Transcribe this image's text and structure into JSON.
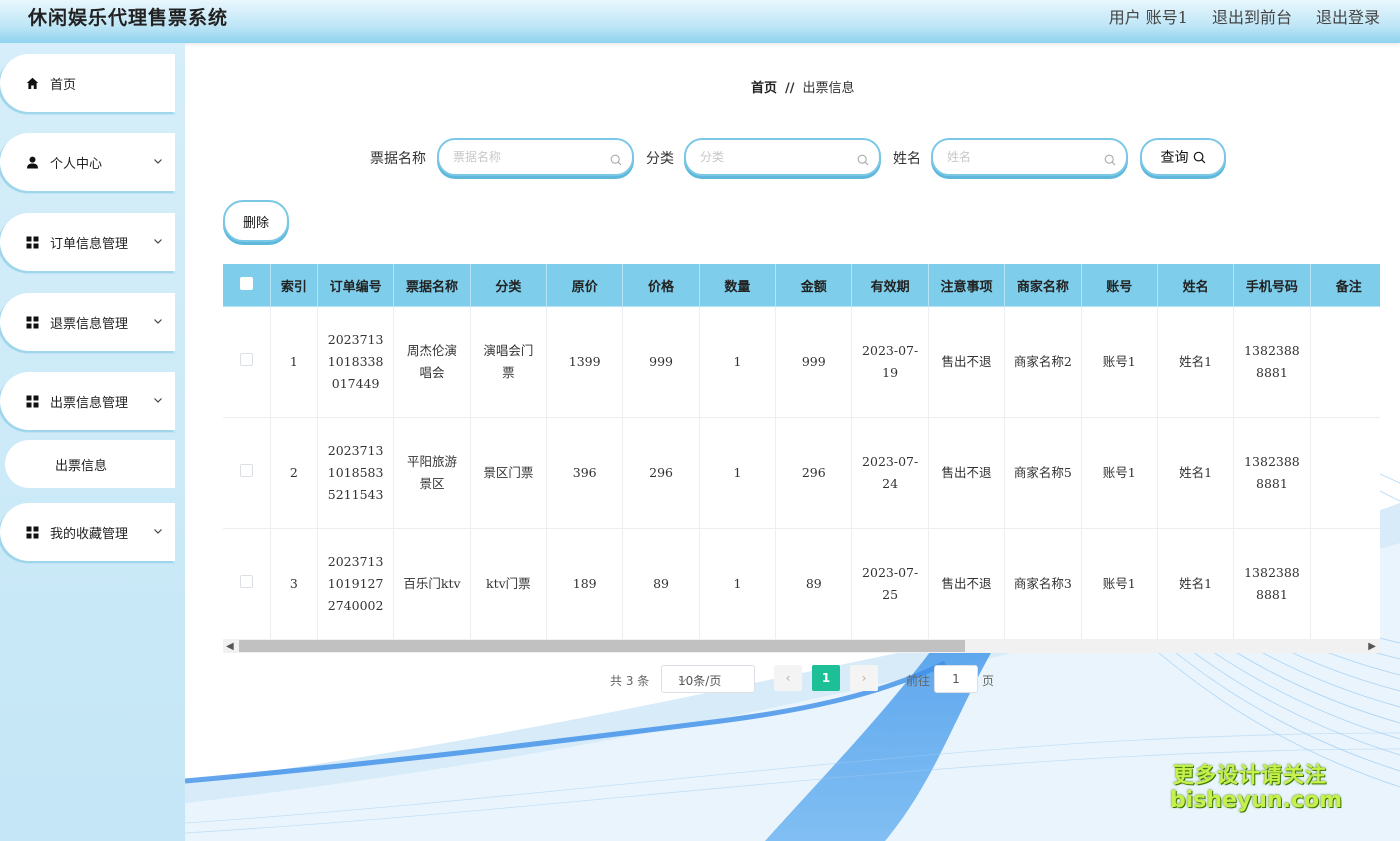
{
  "header": {
    "title": "休闲娱乐代理售票系统",
    "user": "用户 账号1",
    "to_front": "退出到前台",
    "logout": "退出登录"
  },
  "sidebar": {
    "items": [
      {
        "label": "首页",
        "icon": "home-icon"
      },
      {
        "label": "个人中心",
        "icon": "user-icon"
      },
      {
        "label": "订单信息管理",
        "icon": "grid-icon"
      },
      {
        "label": "退票信息管理",
        "icon": "grid-icon"
      },
      {
        "label": "出票信息管理",
        "icon": "grid-icon"
      },
      {
        "label": "我的收藏管理",
        "icon": "grid-icon"
      }
    ],
    "sub_item": "出票信息"
  },
  "breadcrumb": {
    "home": "首页",
    "separator": "//",
    "current": "出票信息"
  },
  "search": {
    "ticket_label": "票据名称",
    "ticket_placeholder": "票据名称",
    "category_label": "分类",
    "category_placeholder": "分类",
    "name_label": "姓名",
    "name_placeholder": "姓名",
    "query_button": "查询"
  },
  "actions": {
    "delete_button": "删除"
  },
  "table": {
    "columns": [
      "索引",
      "订单编号",
      "票据名称",
      "分类",
      "原价",
      "价格",
      "数量",
      "金额",
      "有效期",
      "注意事项",
      "商家名称",
      "账号",
      "姓名",
      "手机号码",
      "备注"
    ],
    "rows": [
      [
        "1",
        "20237131018338017449",
        "周杰伦演唱会",
        "演唱会门票",
        "1399",
        "999",
        "1",
        "999",
        "2023-07-19",
        "售出不退",
        "商家名称2",
        "账号1",
        "姓名1",
        "13823888881",
        ""
      ],
      [
        "2",
        "202371310185835211543",
        "平阳旅游景区",
        "景区门票",
        "396",
        "296",
        "1",
        "296",
        "2023-07-24",
        "售出不退",
        "商家名称5",
        "账号1",
        "姓名1",
        "13823888881",
        ""
      ],
      [
        "3",
        "202371310191272740002",
        "百乐门ktv",
        "ktv门票",
        "189",
        "89",
        "1",
        "89",
        "2023-07-25",
        "售出不退",
        "商家名称3",
        "账号1",
        "姓名1",
        "13823888881",
        ""
      ]
    ]
  },
  "pagination": {
    "total": "共 3 条",
    "page_size": "10条/页",
    "prev": "‹",
    "current": "1",
    "next": "›",
    "goto_label": "前往",
    "goto_value": "1",
    "page_suffix": "页"
  },
  "watermark": {
    "line1": "更多设计请关注",
    "line2": "bisheyun.com"
  },
  "colors": {
    "accent": "#7dcdeb",
    "page_active": "#1dbf96",
    "border": "#7bc8e6"
  }
}
